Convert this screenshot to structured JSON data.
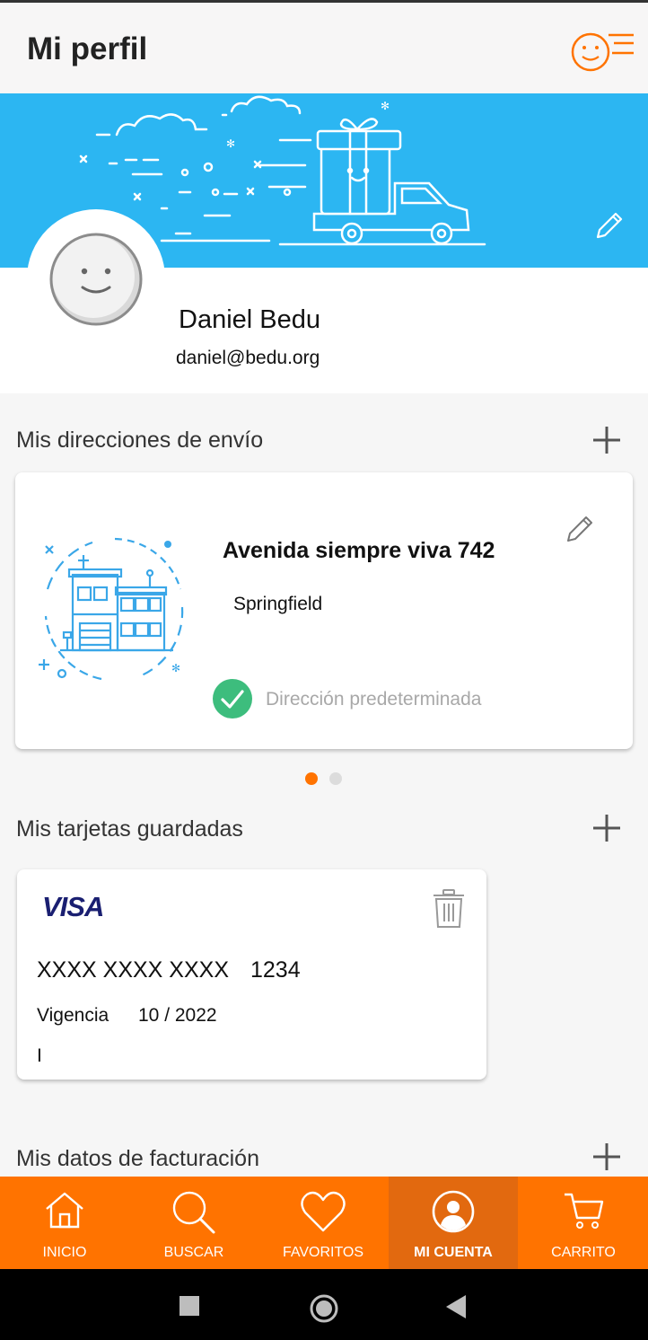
{
  "header": {
    "title": "Mi perfil"
  },
  "profile": {
    "name": "Daniel Bedu",
    "email": "daniel@bedu.org"
  },
  "addresses": {
    "title": "Mis direcciones de envío",
    "items": [
      {
        "street": "Avenida siempre viva 742",
        "city": "Springfield",
        "default_label": "Dirección predeterminada"
      }
    ],
    "pager": {
      "count": 2,
      "active": 0
    }
  },
  "cards": {
    "title": "Mis tarjetas guardadas",
    "items": [
      {
        "brand": "VISA",
        "masked": "XXXX XXXX XXXX",
        "last4": "1234",
        "validity_label": "Vigencia",
        "expiry": "10 / 2022",
        "holder": "I"
      }
    ]
  },
  "billing": {
    "title": "Mis datos de facturación"
  },
  "nav": {
    "items": [
      {
        "label": "INICIO",
        "icon": "home-icon"
      },
      {
        "label": "BUSCAR",
        "icon": "search-icon"
      },
      {
        "label": "FAVORITOS",
        "icon": "heart-icon"
      },
      {
        "label": "MI CUENTA",
        "icon": "account-icon",
        "active": true
      },
      {
        "label": "CARRITO",
        "icon": "cart-icon"
      }
    ]
  },
  "colors": {
    "accent": "#ff7300",
    "banner": "#2cb6f2",
    "success": "#3dbd7d"
  },
  "system_nav": {
    "icons": [
      "recents-icon",
      "home-circle-icon",
      "back-icon"
    ]
  }
}
